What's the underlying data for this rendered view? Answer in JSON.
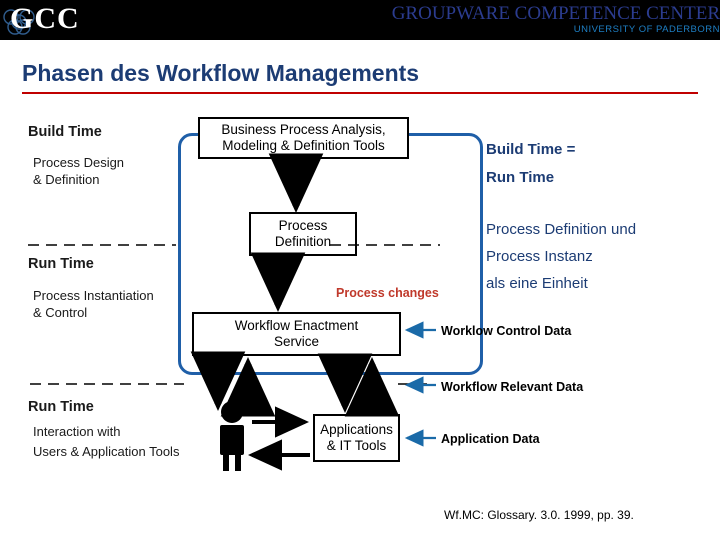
{
  "banner": {
    "logo_text": "GCC",
    "title": "GROUPWARE COMPETENCE CENTER",
    "subtitle": "UNIVERSITY OF PADERBORN"
  },
  "slide": {
    "title": "Phasen des Workflow Managements",
    "footnote": "Wf.MC: Glossary. 3.0. 1999, pp. 39."
  },
  "left_labels": {
    "build_time_heading": "Build Time",
    "build_time_desc_l1": "Process Design",
    "build_time_desc_l2": "& Definition",
    "run_time_heading_1": "Run Time",
    "run_time_desc_1_l1": "Process Instantiation",
    "run_time_desc_1_l2": "& Control",
    "run_time_heading_2": "Run Time",
    "run_time_desc_2_l1": "Interaction with",
    "run_time_desc_2_l2": "Users & Application Tools"
  },
  "boxes": {
    "analysis_l1": "Business Process Analysis,",
    "analysis_l2": "Modeling & Definition Tools",
    "definition_l1": "Process",
    "definition_l2": "Definition",
    "enactment_l1": "Workflow Enactment",
    "enactment_l2": "Service",
    "applications_l1": "Applications",
    "applications_l2": "& IT Tools"
  },
  "annotations": {
    "process_changes": "Process changes",
    "workflow_control_data": "Worklow Control Data",
    "workflow_relevant_data": "Workflow Relevant Data",
    "application_data": "Application Data"
  },
  "right_notes": {
    "note1_l1": "Build Time =",
    "note1_l2": "Run Time",
    "note2_l1": "Process Definition und",
    "note2_l2": "Process Instanz",
    "note2_l3": "als eine Einheit"
  },
  "colors": {
    "title": "#1c3c74",
    "rule": "#c00000",
    "blue_frame": "#1f5fa8",
    "process_changes": "#c0392b",
    "banner_bg": "#000000",
    "banner_title": "#2b3c8f",
    "banner_sub": "#1e7fc4"
  }
}
